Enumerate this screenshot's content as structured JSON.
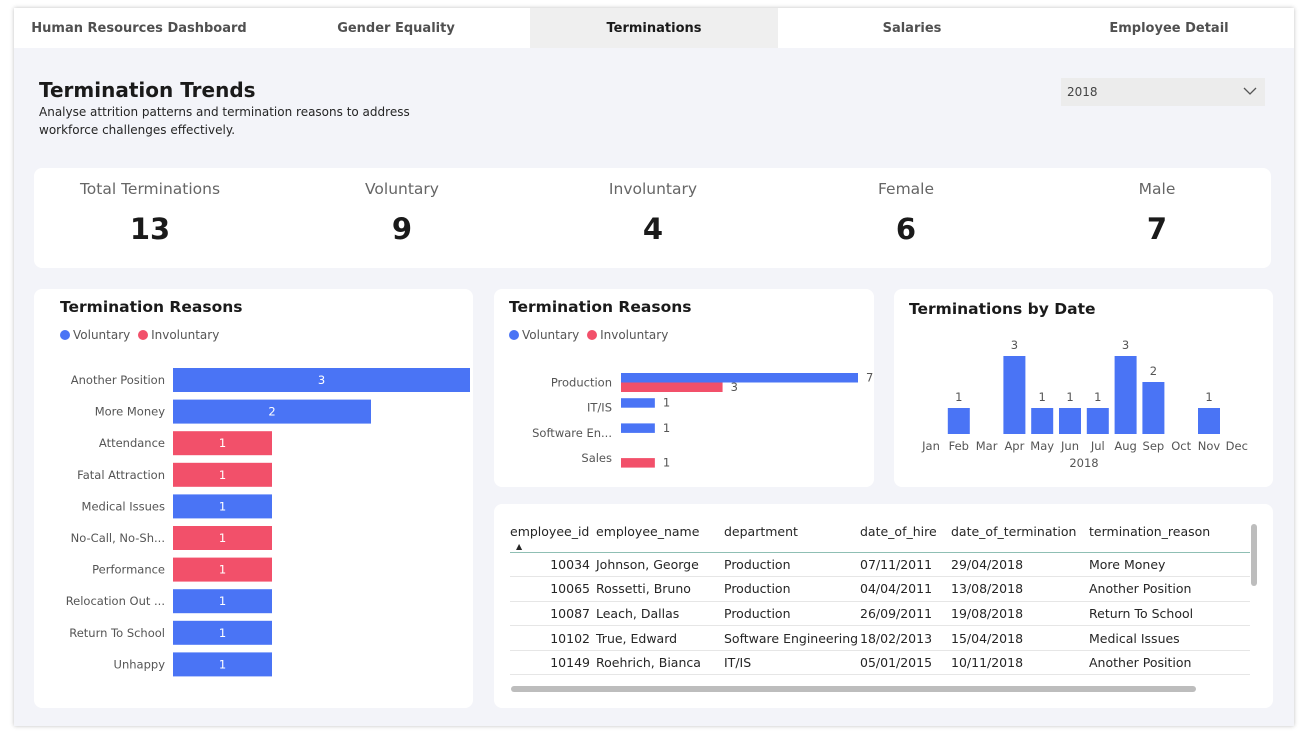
{
  "tabs": [
    {
      "label": "Human Resources Dashboard"
    },
    {
      "label": "Gender Equality"
    },
    {
      "label": "Terminations"
    },
    {
      "label": "Salaries"
    },
    {
      "label": "Employee Detail"
    }
  ],
  "header": {
    "title": "Termination Trends",
    "subtitle": "Analyse attrition patterns and termination reasons to address workforce challenges effectively."
  },
  "year_filter": {
    "selected": "2018"
  },
  "kpis": [
    {
      "label": "Total Terminations",
      "value": "13"
    },
    {
      "label": "Voluntary",
      "value": "9"
    },
    {
      "label": "Involuntary",
      "value": "4"
    },
    {
      "label": "Female",
      "value": "6"
    },
    {
      "label": "Male",
      "value": "7"
    }
  ],
  "colors": {
    "voluntary": "#4a74f5",
    "involuntary": "#f2506a"
  },
  "legend": {
    "voluntary": "Voluntary",
    "involuntary": "Involuntary"
  },
  "reasons_card": {
    "title": "Termination Reasons"
  },
  "dept_card": {
    "title": "Termination Reasons"
  },
  "date_card": {
    "title": "Terminations by Date"
  },
  "chart_data": [
    {
      "type": "bar",
      "orientation": "horizontal",
      "title": "Termination Reasons",
      "categories": [
        "Another Position",
        "More Money",
        "Attendance",
        "Fatal Attraction",
        "Medical Issues",
        "No-Call, No-Sh...",
        "Performance",
        "Relocation Out ...",
        "Return To School",
        "Unhappy"
      ],
      "values": [
        3,
        2,
        1,
        1,
        1,
        1,
        1,
        1,
        1,
        1
      ],
      "bar_type": [
        "voluntary",
        "voluntary",
        "involuntary",
        "involuntary",
        "voluntary",
        "involuntary",
        "involuntary",
        "voluntary",
        "voluntary",
        "voluntary"
      ],
      "legend": [
        "Voluntary",
        "Involuntary"
      ],
      "xlim": [
        0,
        3
      ]
    },
    {
      "type": "bar",
      "orientation": "horizontal",
      "title": "Termination Reasons",
      "categories": [
        "Production",
        "IT/IS",
        "Software En...",
        "Sales"
      ],
      "series": [
        {
          "name": "Voluntary",
          "values": [
            7,
            1,
            1,
            0
          ]
        },
        {
          "name": "Involuntary",
          "values": [
            3,
            0,
            0,
            1
          ]
        }
      ],
      "xlim": [
        0,
        7
      ]
    },
    {
      "type": "bar",
      "title": "Terminations by Date",
      "categories": [
        "Jan",
        "Feb",
        "Mar",
        "Apr",
        "May",
        "Jun",
        "Jul",
        "Aug",
        "Sep",
        "Oct",
        "Nov",
        "Dec"
      ],
      "values": [
        0,
        1,
        0,
        3,
        1,
        1,
        1,
        3,
        2,
        0,
        1,
        0
      ],
      "xlabel": "2018",
      "ylim": [
        0,
        3
      ]
    }
  ],
  "table": {
    "columns": [
      "employee_id",
      "employee_name",
      "department",
      "date_of_hire",
      "date_of_termination",
      "termination_reason"
    ],
    "rows": [
      [
        "10034",
        "Johnson, George",
        "Production",
        "07/11/2011",
        "29/04/2018",
        "More Money"
      ],
      [
        "10065",
        "Rossetti, Bruno",
        "Production",
        "04/04/2011",
        "13/08/2018",
        "Another Position"
      ],
      [
        "10087",
        "Leach, Dallas",
        "Production",
        "26/09/2011",
        "19/08/2018",
        "Return To School"
      ],
      [
        "10102",
        "True, Edward",
        "Software Engineering",
        "18/02/2013",
        "15/04/2018",
        "Medical Issues"
      ],
      [
        "10149",
        "Roehrich, Bianca",
        "IT/IS",
        "05/01/2015",
        "10/11/2018",
        "Another Position"
      ]
    ]
  }
}
